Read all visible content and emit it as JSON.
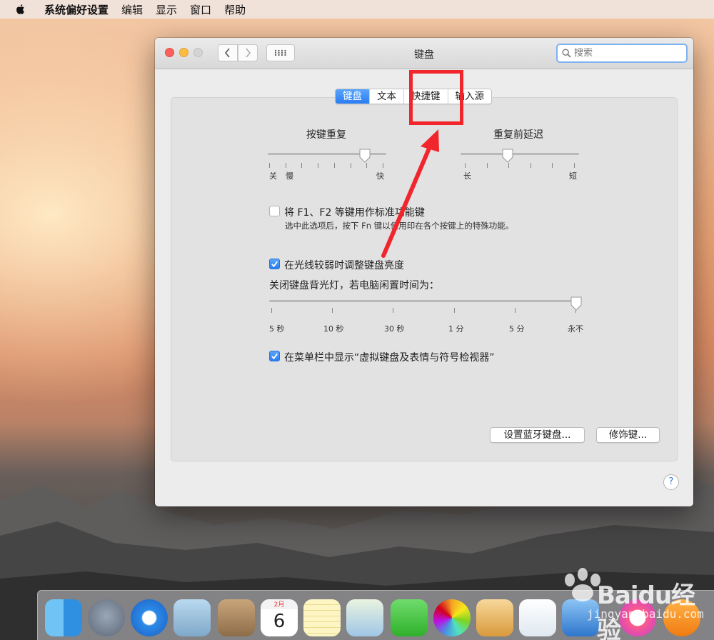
{
  "menubar": {
    "items": [
      {
        "label": "系统偏好设置",
        "bold": true
      },
      {
        "label": "编辑"
      },
      {
        "label": "显示"
      },
      {
        "label": "窗口"
      },
      {
        "label": "帮助"
      }
    ]
  },
  "window": {
    "title": "键盘",
    "search_placeholder": "搜索"
  },
  "tabs": [
    {
      "label": "键盘",
      "active": true
    },
    {
      "label": "文本"
    },
    {
      "label": "快捷键",
      "highlighted": true
    },
    {
      "label": "输入源"
    }
  ],
  "key_repeat": {
    "title": "按键重复",
    "label_off": "关",
    "label_slow": "慢",
    "label_fast": "快",
    "position_fraction": 0.82
  },
  "repeat_delay": {
    "title": "重复前延迟",
    "label_long": "长",
    "label_short": "短",
    "position_fraction": 0.4
  },
  "fn_option": {
    "label": "将 F1、F2 等键用作标准功能键",
    "note": "选中此选项后，按下 Fn 键以使用印在各个按键上的特殊功能。",
    "checked": false
  },
  "brightness_option": {
    "label": "在光线较弱时调整键盘亮度",
    "checked": true
  },
  "backlight": {
    "title": "关闭键盘背光灯，若电脑闲置时间为：",
    "labels": [
      "5 秒",
      "10 秒",
      "30 秒",
      "1 分",
      "5 分",
      "永不"
    ],
    "selected": "永不"
  },
  "menubar_option": {
    "label": "在菜单栏中显示“虚拟键盘及表情与符号检视器”",
    "checked": true
  },
  "buttons": {
    "bluetooth": "设置蓝牙键盘...",
    "modifier": "修饰键..."
  },
  "help_label": "?",
  "calendar": {
    "month": "2月",
    "day": "6"
  },
  "watermark": {
    "brand": "Baidu经验",
    "url": "jingyan.baidu.com"
  },
  "colors": {
    "accent": "#2a7df3",
    "highlight": "#f1262c"
  }
}
